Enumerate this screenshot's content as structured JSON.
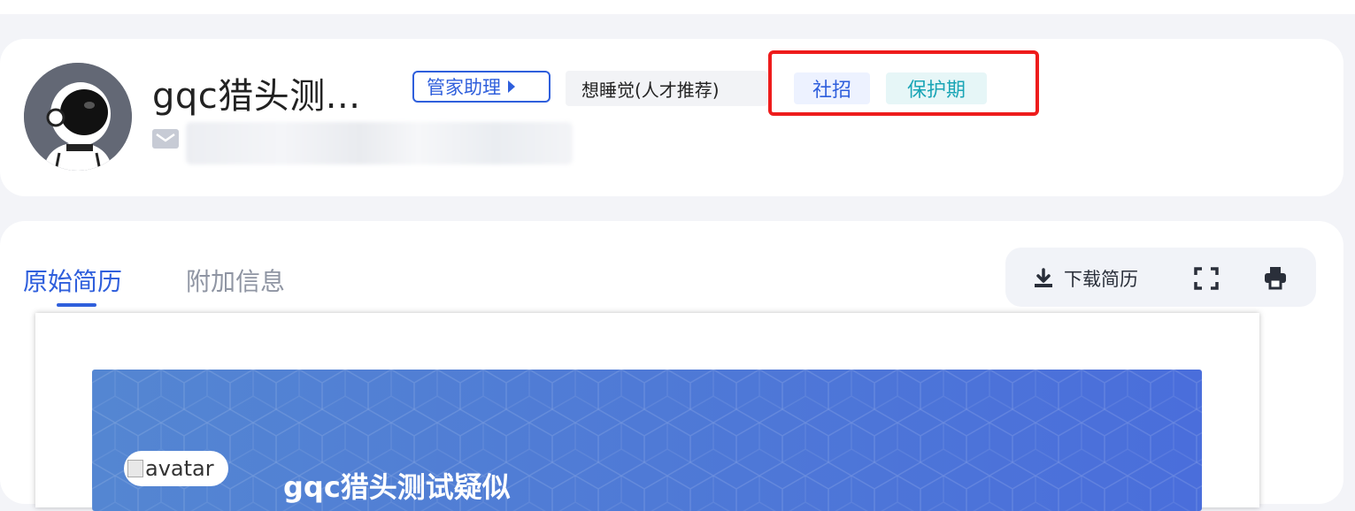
{
  "profile": {
    "name": "gqc猎头测...",
    "agent_tag": "管家助理",
    "channel_tag": "想睡觉(人才推荐)",
    "type_tag": "社招",
    "status_tag": "保护期"
  },
  "tabs": [
    {
      "label": "原始简历",
      "active": true
    },
    {
      "label": "附加信息",
      "active": false
    }
  ],
  "toolbar": {
    "download_label": "下载简历"
  },
  "resume": {
    "avatar_alt": "avatar",
    "name": "gqc猎头测试疑似"
  },
  "colors": {
    "accent": "#2f5fdc",
    "protect": "#1aa5b6",
    "highlight": "#ee1c1c"
  }
}
